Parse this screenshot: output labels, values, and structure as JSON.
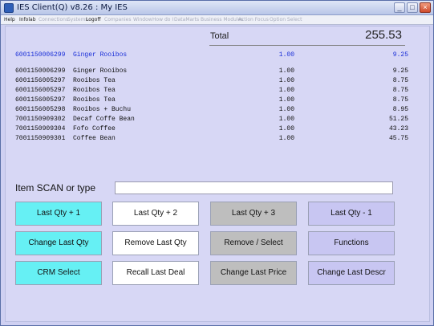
{
  "window": {
    "title": "IES Client(Q) v8.26 : My IES"
  },
  "menubar": {
    "items": [
      {
        "label": "Help",
        "enabled": true
      },
      {
        "label": "Infolab",
        "enabled": true
      },
      {
        "label": "Connections",
        "enabled": false
      },
      {
        "label": "Systems",
        "enabled": false
      },
      {
        "label": "Logoff",
        "enabled": true
      },
      {
        "label": "Companies",
        "enabled": false
      },
      {
        "label": "Window",
        "enabled": false
      },
      {
        "label": "How do I",
        "enabled": false
      },
      {
        "label": "DataMarts",
        "enabled": false
      },
      {
        "label": "Business Modules",
        "enabled": false
      },
      {
        "label": "Action Focus",
        "enabled": false
      },
      {
        "label": "Option Select",
        "enabled": false
      }
    ]
  },
  "totals": {
    "label": "Total",
    "value": "255.53"
  },
  "current_line": {
    "code": "6001150006299",
    "description": "Ginger Rooibos",
    "qty": "1.00",
    "amount": "9.25"
  },
  "lines": [
    {
      "code": "6001150006299",
      "description": "Ginger Rooibos",
      "qty": "1.00",
      "amount": "9.25"
    },
    {
      "code": "6001156005297",
      "description": "Rooibos Tea",
      "qty": "1.00",
      "amount": "8.75"
    },
    {
      "code": "6001156005297",
      "description": "Rooibos Tea",
      "qty": "1.00",
      "amount": "8.75"
    },
    {
      "code": "6001156005297",
      "description": "Rooibos Tea",
      "qty": "1.00",
      "amount": "8.75"
    },
    {
      "code": "6001156005298",
      "description": "Rooibos + Buchu",
      "qty": "1.00",
      "amount": "8.95"
    },
    {
      "code": "7001150909302",
      "description": "Decaf Coffe Bean",
      "qty": "1.00",
      "amount": "51.25"
    },
    {
      "code": "7001150909304",
      "description": "Fofo Coffee",
      "qty": "1.00",
      "amount": "43.23"
    },
    {
      "code": "7001150909301",
      "description": "Coffee Bean",
      "qty": "1.00",
      "amount": "45.75"
    }
  ],
  "scan": {
    "label": "Item SCAN or type",
    "value": ""
  },
  "buttons": {
    "last_qty_plus_1": "Last Qty + 1",
    "last_qty_plus_2": "Last Qty + 2",
    "last_qty_plus_3": "Last Qty + 3",
    "last_qty_minus_1": "Last Qty - 1",
    "change_last_qty": "Change Last Qty",
    "remove_last_qty": "Remove Last Qty",
    "remove_select": "Remove / Select",
    "functions": "Functions",
    "crm_select": "CRM Select",
    "recall_last_deal": "Recall Last Deal",
    "change_last_price": "Change Last Price",
    "change_last_descr": "Change Last Descr"
  },
  "colors": {
    "cyan_button": "#66f0f4",
    "white_button": "#ffffff",
    "grey_button": "#bebebe",
    "lavender_button": "#c8c6f2",
    "panel_background": "#d7d7f5",
    "current_line_text": "#1a2fd8"
  }
}
